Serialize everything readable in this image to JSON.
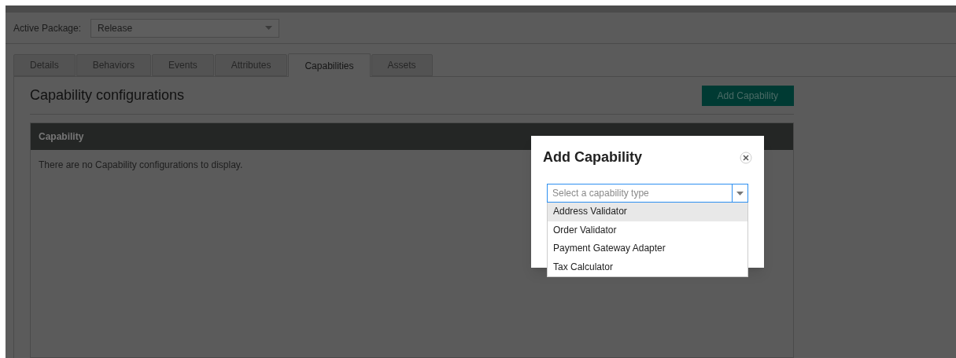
{
  "active_package": {
    "label": "Active Package:",
    "value": "Release"
  },
  "tabs": [
    {
      "label": "Details",
      "selected": false
    },
    {
      "label": "Behaviors",
      "selected": false
    },
    {
      "label": "Events",
      "selected": false
    },
    {
      "label": "Attributes",
      "selected": false
    },
    {
      "label": "Capabilities",
      "selected": true
    },
    {
      "label": "Assets",
      "selected": false
    }
  ],
  "section": {
    "title": "Capability configurations",
    "add_button": "Add Capability"
  },
  "table": {
    "columns": [
      "Capability"
    ],
    "empty_message": "There are no Capability configurations to display."
  },
  "dialog": {
    "title": "Add Capability",
    "select": {
      "placeholder": "Select a capability type"
    },
    "options": [
      {
        "label": "Address Validator",
        "highlighted": true
      },
      {
        "label": "Order Validator",
        "highlighted": false
      },
      {
        "label": "Payment Gateway Adapter",
        "highlighted": false
      },
      {
        "label": "Tax Calculator",
        "highlighted": false
      }
    ]
  }
}
